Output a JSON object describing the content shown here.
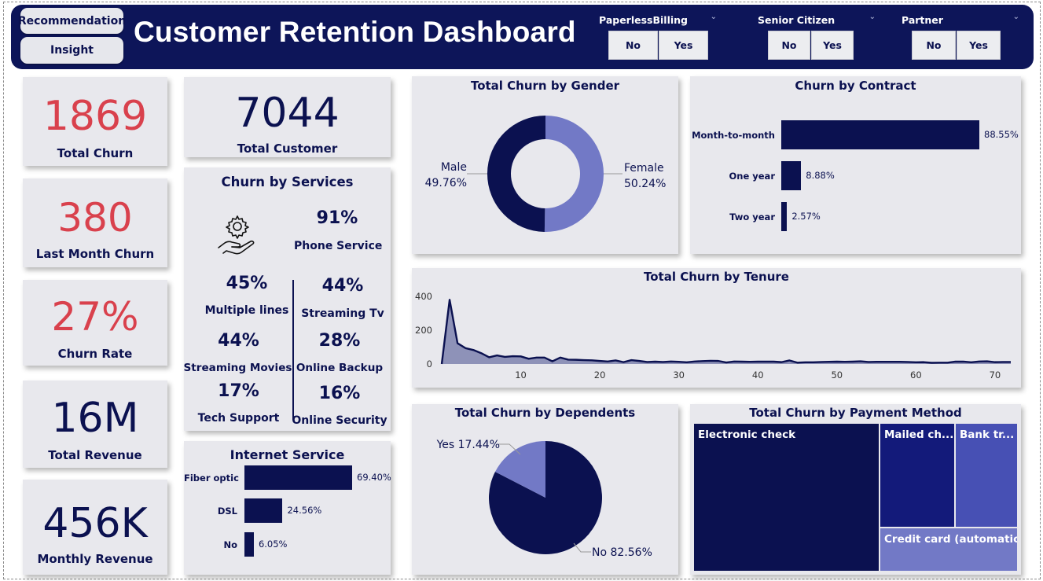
{
  "header": {
    "title": "Customer Retention Dashboard",
    "nav_recommendation": "Recommendation",
    "nav_insight": "Insight",
    "slicers": [
      {
        "title": "PaperlessBilling",
        "options": [
          "No",
          "Yes"
        ]
      },
      {
        "title": "Senior Citizen",
        "options": [
          "No",
          "Yes"
        ]
      },
      {
        "title": "Partner",
        "options": [
          "No",
          "Yes"
        ]
      }
    ],
    "chevron": "⌄"
  },
  "kpis": {
    "total_churn": {
      "value": "1869",
      "label": "Total Churn"
    },
    "last_month_churn": {
      "value": "380",
      "label": "Last Month Churn"
    },
    "churn_rate": {
      "value": "27%",
      "label": "Churn Rate"
    },
    "total_revenue": {
      "value": "16M",
      "label": "Total Revenue"
    },
    "monthly_revenue": {
      "value": "456K",
      "label": "Monthly Revenue"
    },
    "total_customer": {
      "value": "7044",
      "label": "Total Customer"
    }
  },
  "services": {
    "title": "Churn by Services",
    "icon": "gear-hand-icon",
    "items": [
      {
        "pct": "91%",
        "label": "Phone Service"
      },
      {
        "pct": "45%",
        "label": "Multiple lines"
      },
      {
        "pct": "44%",
        "label": "Streaming Tv"
      },
      {
        "pct": "44%",
        "label": "Streaming Movies"
      },
      {
        "pct": "28%",
        "label": "Online Backup"
      },
      {
        "pct": "17%",
        "label": "Tech Support"
      },
      {
        "pct": "16%",
        "label": "Online Security"
      }
    ]
  },
  "colors": {
    "navy": "#0b1150",
    "header_bg": "#0d1559",
    "kpi_red": "#d9414d",
    "light_purple": "#7279c6",
    "card_bg": "#e8e8ed"
  },
  "chart_data": [
    {
      "id": "gender",
      "type": "pie",
      "title": "Total Churn by Gender",
      "labels": [
        "Male",
        "Female"
      ],
      "values": [
        49.76,
        50.24
      ],
      "display": [
        "49.76%",
        "50.24%"
      ],
      "colors": [
        "#0b1150",
        "#7279c6"
      ],
      "donut": true
    },
    {
      "id": "contract",
      "type": "bar",
      "orientation": "horizontal",
      "title": "Churn by Contract",
      "categories": [
        "Month-to-month",
        "One year",
        "Two year"
      ],
      "values": [
        88.55,
        8.88,
        2.57
      ],
      "display": [
        "88.55%",
        "8.88%",
        "2.57%"
      ]
    },
    {
      "id": "tenure",
      "type": "area",
      "title": "Total Churn by Tenure",
      "xlim": [
        0,
        72
      ],
      "ylim": [
        0,
        400
      ],
      "x_ticks": [
        10,
        20,
        30,
        40,
        50,
        60,
        70
      ],
      "y_ticks": [
        0,
        200,
        400
      ],
      "x": [
        0,
        1,
        2,
        3,
        4,
        5,
        6,
        7,
        8,
        9,
        10,
        11,
        12,
        13,
        14,
        15,
        16,
        17,
        18,
        19,
        20,
        21,
        22,
        23,
        24,
        25,
        26,
        27,
        28,
        29,
        30,
        31,
        32,
        33,
        34,
        35,
        36,
        37,
        38,
        39,
        40,
        41,
        42,
        43,
        44,
        45,
        46,
        47,
        48,
        49,
        50,
        51,
        52,
        53,
        54,
        55,
        56,
        57,
        58,
        59,
        60,
        61,
        62,
        63,
        64,
        65,
        66,
        67,
        68,
        69,
        70,
        71,
        72
      ],
      "y": [
        0,
        380,
        123,
        94,
        83,
        64,
        40,
        51,
        42,
        46,
        45,
        31,
        38,
        38,
        16,
        38,
        26,
        25,
        23,
        22,
        18,
        15,
        21,
        11,
        23,
        18,
        12,
        14,
        12,
        15,
        13,
        10,
        15,
        17,
        19,
        18,
        9,
        15,
        14,
        13,
        14,
        14,
        14,
        11,
        21,
        8,
        10,
        10,
        12,
        13,
        14,
        13,
        14,
        16,
        12,
        13,
        13,
        13,
        13,
        12,
        10,
        11,
        7,
        8,
        8,
        14,
        14,
        10,
        15,
        16,
        11,
        12,
        12
      ]
    },
    {
      "id": "dependents",
      "type": "pie",
      "title": "Total Churn by Dependents",
      "labels": [
        "Yes",
        "No"
      ],
      "values": [
        17.44,
        82.56
      ],
      "display": [
        "Yes 17.44%",
        "No 82.56%"
      ],
      "colors": [
        "#7279c6",
        "#0b1150"
      ]
    },
    {
      "id": "internet",
      "type": "bar",
      "orientation": "horizontal",
      "title": "Internet Service",
      "categories": [
        "Fiber optic",
        "DSL",
        "No"
      ],
      "values": [
        69.4,
        24.56,
        6.05
      ],
      "display": [
        "69.40%",
        "24.56%",
        "6.05%"
      ]
    },
    {
      "id": "payment",
      "type": "heatmap",
      "title": "Total Churn by Payment Method",
      "categories": [
        "Electronic check",
        "Mailed ch...",
        "Bank tr...",
        "Credit card (automatic)"
      ],
      "colors": [
        "#0b1150",
        "#131a7a",
        "#4750b4",
        "#7279c6"
      ]
    }
  ]
}
